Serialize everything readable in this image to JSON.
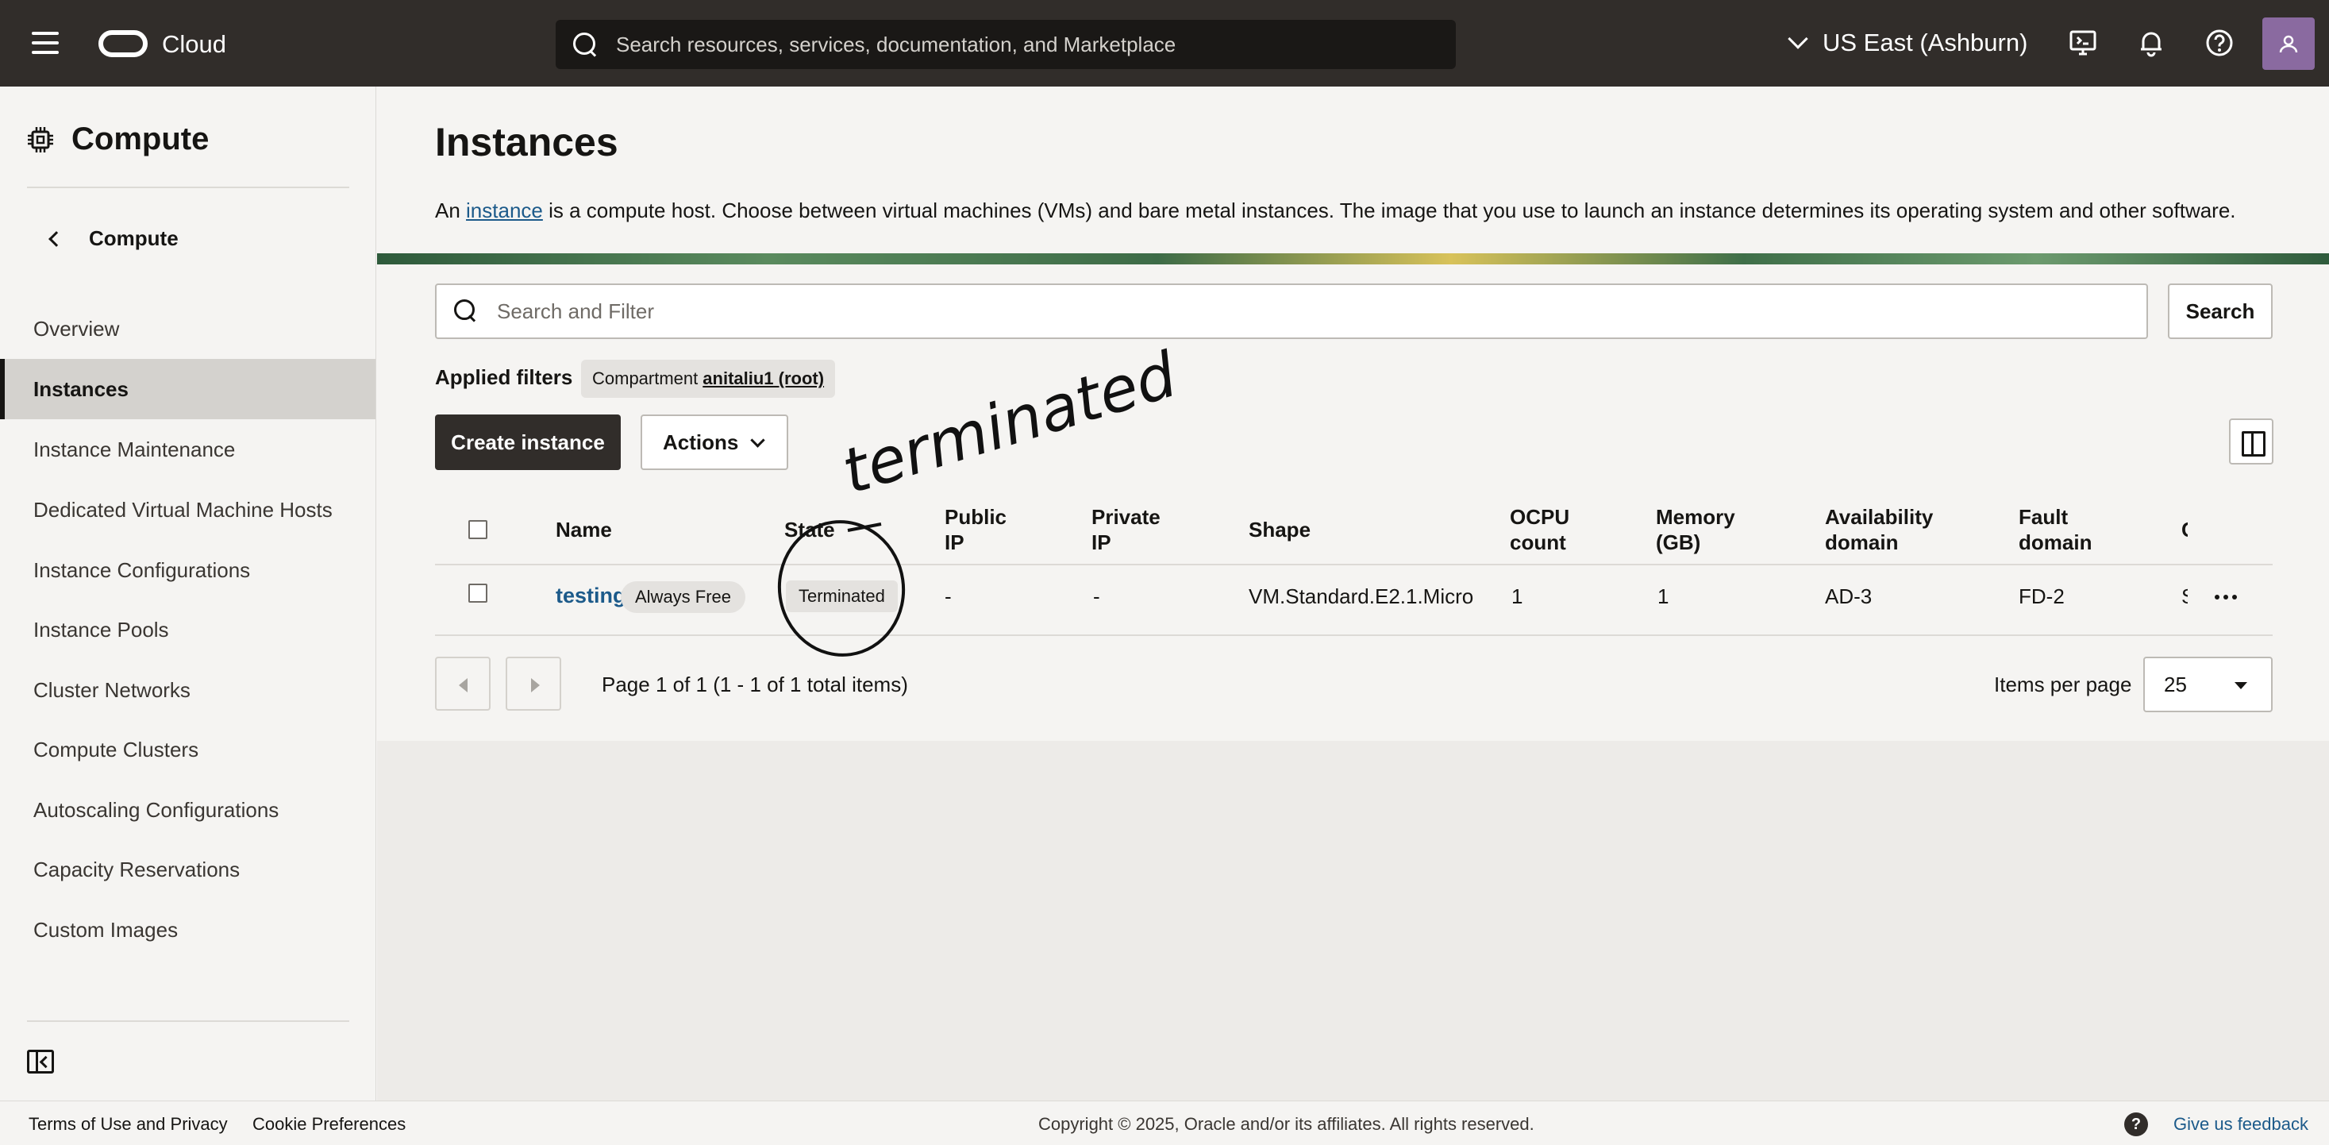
{
  "topbar": {
    "brand": "Cloud",
    "search_placeholder": "Search resources, services, documentation, and Marketplace",
    "region": "US East (Ashburn)"
  },
  "sidebar": {
    "title": "Compute",
    "back_label": "Compute",
    "items": [
      {
        "label": "Overview"
      },
      {
        "label": "Instances",
        "active": true
      },
      {
        "label": "Instance Maintenance"
      },
      {
        "label": "Dedicated Virtual Machine Hosts"
      },
      {
        "label": "Instance Configurations"
      },
      {
        "label": "Instance Pools"
      },
      {
        "label": "Cluster Networks"
      },
      {
        "label": "Compute Clusters"
      },
      {
        "label": "Autoscaling Configurations"
      },
      {
        "label": "Capacity Reservations"
      },
      {
        "label": "Custom Images"
      }
    ]
  },
  "main": {
    "title": "Instances",
    "desc_before": "An ",
    "desc_link": "instance",
    "desc_after": " is a compute host. Choose between virtual machines (VMs) and bare metal instances. The image that you use to launch an instance determines its operating system and other software.",
    "filter_placeholder": "Search and Filter",
    "search_button": "Search",
    "applied_filters_label": "Applied filters",
    "filter_chip_label": "Compartment",
    "filter_chip_value": "anitaliu1 (root)",
    "create_button": "Create instance",
    "actions_button": "Actions"
  },
  "table": {
    "headers": {
      "name": "Name",
      "state": "State",
      "public_ip": [
        "Public",
        "IP"
      ],
      "private_ip": [
        "Private",
        "IP"
      ],
      "shape": "Shape",
      "ocpu": [
        "OCPU",
        "count"
      ],
      "memory": [
        "Memory",
        "(GB)"
      ],
      "availability": [
        "Availability",
        "domain"
      ],
      "fault": [
        "Fault",
        "domain"
      ],
      "truncated": "C"
    },
    "rows": [
      {
        "name": "testing",
        "badge": "Always Free",
        "state": "Terminated",
        "public_ip": "-",
        "private_ip": "-",
        "shape": "VM.Standard.E2.1.Micro",
        "ocpu": "1",
        "memory": "1",
        "availability": "AD-3",
        "fault": "FD-2",
        "truncated": "S"
      }
    ]
  },
  "pagination": {
    "info": "Page 1 of 1 (1 - 1 of 1 total items)",
    "items_per_page_label": "Items per page",
    "items_per_page_value": "25"
  },
  "footer": {
    "terms": "Terms of Use and Privacy",
    "cookies": "Cookie Preferences",
    "copyright": "Copyright © 2025, Oracle and/or its affiliates. All rights reserved.",
    "help": "?",
    "feedback": "Give us feedback"
  },
  "annotation": {
    "handwritten_text": "terminated"
  },
  "colors": {
    "topbar": "#312d2a",
    "link": "#1c5a8a",
    "primary_button": "#312d2a",
    "active_nav": "#d4d2ce"
  }
}
